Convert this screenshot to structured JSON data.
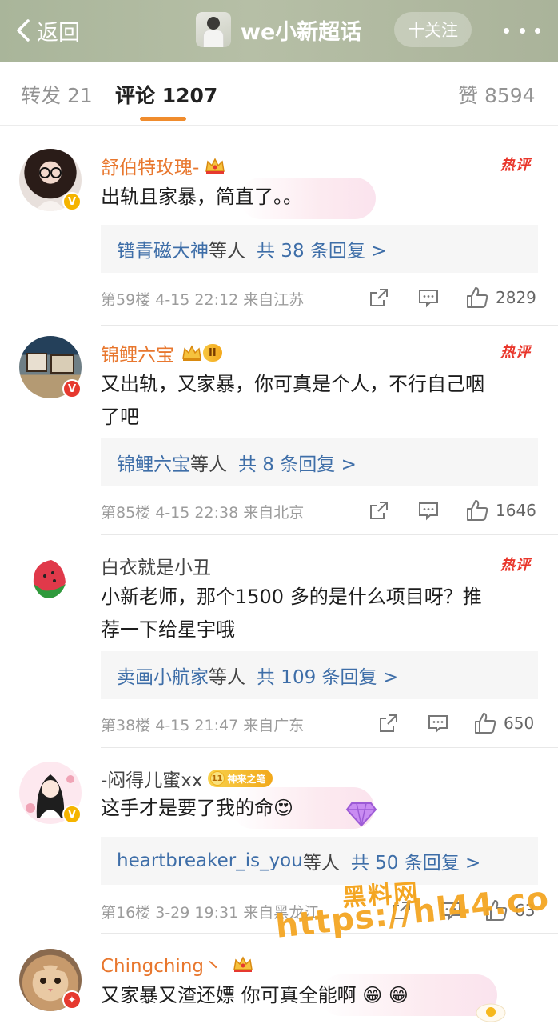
{
  "header": {
    "back_label": "返回",
    "title": "we小新超话",
    "follow_label": "十关注"
  },
  "tabs": [
    {
      "label": "转发",
      "count": "21"
    },
    {
      "label": "评论",
      "count": "1207"
    },
    {
      "label": "赞",
      "count": "8594"
    }
  ],
  "comments": [
    {
      "username": "舒伯特玫瑰-",
      "hot": "热评",
      "text": "出轨且家暴，简直了。。",
      "reply_user": "镨青磁大神",
      "reply_mid": "等人",
      "reply_count": "共 38 条回复 >",
      "floor": "第59楼",
      "date": "4-15",
      "time": "22:12",
      "location": "来自江苏",
      "likes": "2829"
    },
    {
      "username": "锦鲤六宝",
      "level": "II",
      "hot": "热评",
      "text_line1": "又出轨，又家暴，你可真是个人，不行自己咽",
      "text_line2": "了吧",
      "reply_user": "锦鲤六宝",
      "reply_mid": "等人",
      "reply_count": "共 8 条回复 >",
      "floor": "第85楼",
      "date": "4-15",
      "time": "22:38",
      "location": "来自北京",
      "likes": "1646"
    },
    {
      "username": "白衣就是小丑",
      "hot": "热评",
      "text_line1": "小新老师，那个1500 多的是什么项目呀？推",
      "text_line2": "荐一下给星宇哦",
      "reply_user": "卖画小航家",
      "reply_mid": "等人",
      "reply_count": "共 109 条回复 >",
      "floor": "第38楼",
      "date": "4-15",
      "time": "21:47",
      "location": "来自广东",
      "likes": "650"
    },
    {
      "username": "-闷得儿蜜xx",
      "medal_num": "11",
      "medal_label": "神来之笔",
      "text": "这手才是要了我的命",
      "emoji": "😍",
      "reply_user": "heartbreaker_is_you",
      "reply_mid": "等人",
      "reply_count": "共 50 条回复 >",
      "floor": "第16楼",
      "date": "3-29",
      "time": "19:31",
      "location": "来自黑龙江",
      "likes": "63"
    },
    {
      "username": "Chingching丶",
      "text": "又家暴又渣还嫖 你可真全能啊",
      "emoji": "😁 😁"
    }
  ],
  "watermark": {
    "line1": "黑料网",
    "line2": "https://hl44.co"
  },
  "colors": {
    "accent": "#f08c2d",
    "username": "#e8772e",
    "link": "#3e6ea8",
    "hot": "#e9372c",
    "watermark": "#f4a623"
  }
}
